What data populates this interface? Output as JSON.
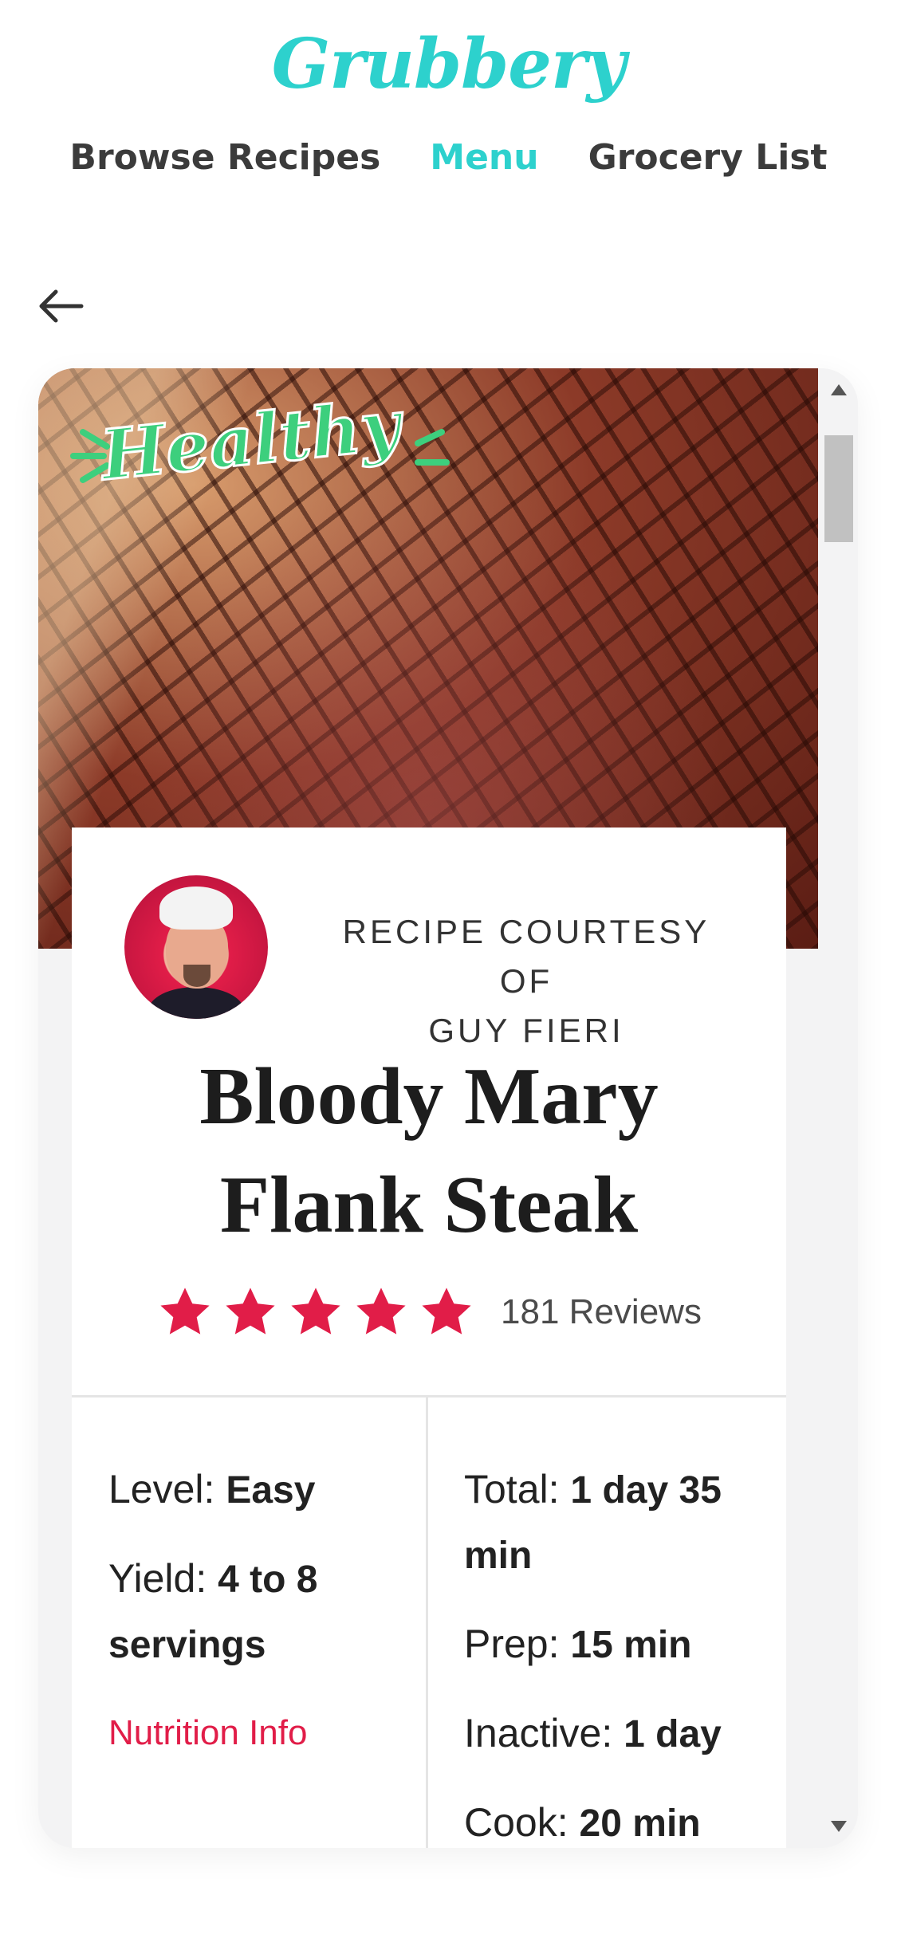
{
  "header": {
    "brand": "Grubbery",
    "nav": [
      "Browse Recipes",
      "Menu",
      "Grocery List"
    ],
    "active_nav": "Menu"
  },
  "recipe": {
    "badge": "Healthy",
    "courtesy_line1": "RECIPE COURTESY OF",
    "courtesy_line2": "GUY FIERI",
    "title_line1": "Bloody Mary",
    "title_line2": "Flank Steak",
    "rating": 5,
    "reviews": "181 Reviews",
    "level_label": "Level:",
    "level_value": "Easy",
    "yield_label": "Yield:",
    "yield_value": "4 to 8 servings",
    "nutrition": "Nutrition Info",
    "total_label": "Total:",
    "total_value": "1 day 35 min",
    "prep_label": "Prep:",
    "prep_value": "15 min",
    "inactive_label": "Inactive:",
    "inactive_value": "1 day",
    "cook_label": "Cook:",
    "cook_value": "20 min"
  },
  "colors": {
    "brand": "#2dd1cd",
    "star": "#e11d48",
    "healthy": "#3dcf7d"
  },
  "icons": {
    "back": "arrow-left-icon",
    "star": "star-icon"
  }
}
